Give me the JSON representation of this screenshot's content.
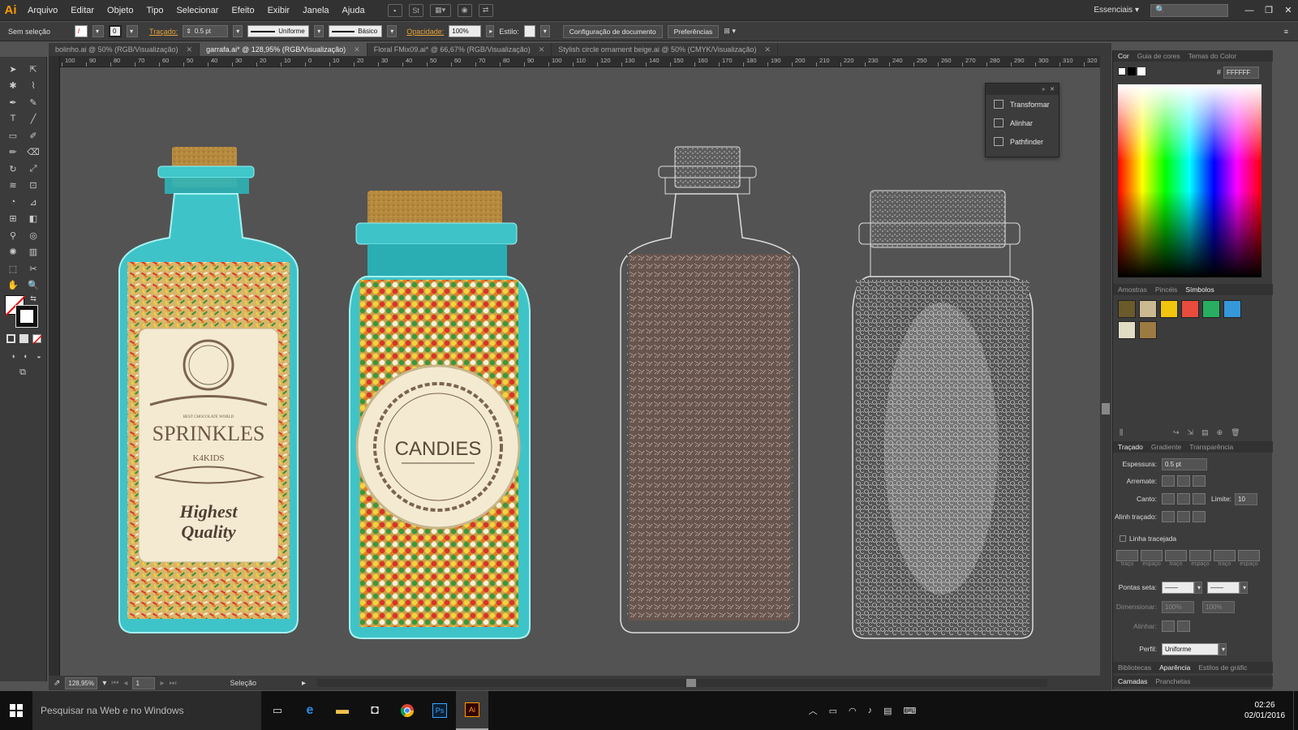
{
  "menubar": {
    "logo": "Ai",
    "items": [
      "Arquivo",
      "Editar",
      "Objeto",
      "Tipo",
      "Selecionar",
      "Efeito",
      "Exibir",
      "Janela",
      "Ajuda"
    ],
    "workspace": "Essenciais",
    "bridge_label": "St"
  },
  "control_bar": {
    "selection": "Sem seleção",
    "stroke_label": "Traçado:",
    "stroke_weight": "0.5 pt",
    "stroke_value_left": "0",
    "profile": "Uniforme",
    "brush": "Básico",
    "opacity_label": "Opacidade:",
    "opacity": "100%",
    "style_label": "Estilo:",
    "doc_setup_button": "Configuração de documento",
    "prefs_button": "Preferências"
  },
  "tabs": [
    {
      "label": "bolinho.ai @ 50% (RGB/Visualização)",
      "active": false
    },
    {
      "label": "garrafa.ai* @ 128,95% (RGB/Visualização)",
      "active": true
    },
    {
      "label": "Floral FMix09.ai* @ 66,67% (RGB/Visualização)",
      "active": false
    },
    {
      "label": "Stylish circle ornament beige.ai @ 50% (CMYK/Visualização)",
      "active": false
    }
  ],
  "ruler": [
    "100",
    "90",
    "80",
    "70",
    "60",
    "50",
    "40",
    "30",
    "20",
    "10",
    "0",
    "10",
    "20",
    "30",
    "40",
    "50",
    "60",
    "70",
    "80",
    "90",
    "100",
    "110",
    "120",
    "130",
    "140",
    "150",
    "160",
    "170",
    "180",
    "190",
    "200",
    "210",
    "220",
    "230",
    "240",
    "250",
    "260",
    "270",
    "280",
    "290",
    "300",
    "310",
    "320"
  ],
  "artwork": {
    "bottle1_title": "SPRINKLES",
    "bottle1_subtitle": "K4KIDS",
    "bottle1_small": "BEST CHOCOLATE WORLD",
    "bottle1_quality_1": "Highest",
    "bottle1_quality_2": "Quality",
    "bottle2_title": "CANDIES"
  },
  "float_panel": {
    "items": [
      "Transformar",
      "Alinhar",
      "Pathfinder"
    ]
  },
  "status": {
    "zoom": "128,95%",
    "artboard": "1",
    "tool": "Seleção"
  },
  "right_panel": {
    "color_tabs": [
      "Cor",
      "Guia de cores",
      "Temas do Color"
    ],
    "hex_label": "#",
    "hex_value": "FFFFFF",
    "symbol_tabs": [
      "Amostras",
      "Pincéis",
      "Símbolos"
    ],
    "stroke_tabs": [
      "Traçado",
      "Gradiente",
      "Transparência"
    ],
    "weight_label": "Espessura:",
    "weight_value": "0.5 pt",
    "cap_label": "Arremate:",
    "corner_label": "Canto:",
    "limit_label": "Limite:",
    "limit_value": "10",
    "align_label": "Alinh traçado:",
    "dashed_label": "Linha tracejada",
    "dash_labels": [
      "traço",
      "espaço",
      "traço",
      "espaço",
      "traço",
      "espaço"
    ],
    "arrows_label": "Pontas seta:",
    "scale_label": "Dimensionar:",
    "scale_value_1": "100%",
    "scale_value_2": "100%",
    "align2_label": "Alinhar:",
    "profile_label": "Perfil:",
    "profile_value": "Uniforme",
    "bottom_tabs_1": [
      "Bibliotecas",
      "Aparência",
      "Estilos de gráfic"
    ],
    "bottom_tabs_2": [
      "Camadas",
      "Pranchetas"
    ]
  },
  "taskbar": {
    "search": "Pesquisar na Web e no Windows",
    "time": "02:26",
    "date": "02/01/2016"
  }
}
